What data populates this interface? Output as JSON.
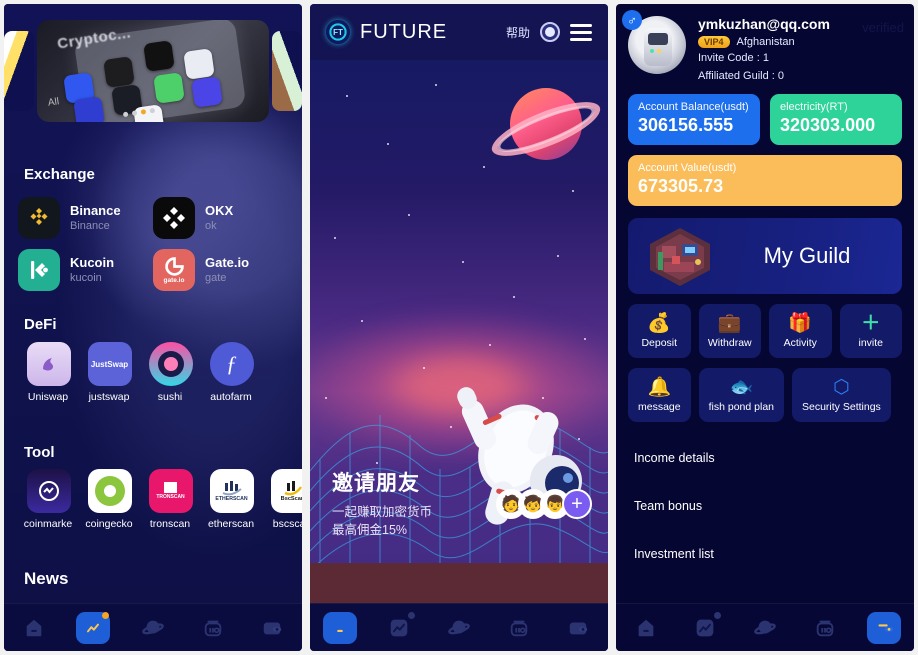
{
  "left_panel": {
    "carousel": {
      "photo_caption": "Cryptoc...",
      "photo_sublabel": "All"
    },
    "sections": [
      {
        "title": "Exchange",
        "type": "exchange",
        "items": [
          {
            "name": "Binance",
            "sub": "Binance",
            "icon": "binance-icon"
          },
          {
            "name": "OKX",
            "sub": "ok",
            "icon": "okx-icon"
          },
          {
            "name": "Kucoin",
            "sub": "kucoin",
            "icon": "kucoin-icon"
          },
          {
            "name": "Gate.io",
            "sub": "gate",
            "icon": "gateio-icon"
          }
        ]
      },
      {
        "title": "DeFi",
        "type": "apps",
        "items": [
          {
            "name": "Uniswap",
            "icon": "uniswap-icon"
          },
          {
            "name": "justswap",
            "icon": "justswap-icon"
          },
          {
            "name": "sushi",
            "icon": "sushi-icon"
          },
          {
            "name": "autofarm",
            "icon": "autofarm-icon"
          }
        ]
      },
      {
        "title": "Tool",
        "type": "apps",
        "items": [
          {
            "name": "coinmarke",
            "icon": "coinmarketcap-icon"
          },
          {
            "name": "coingecko",
            "icon": "coingecko-icon"
          },
          {
            "name": "tronscan",
            "icon": "tronscan-icon"
          },
          {
            "name": "etherscan",
            "icon": "etherscan-icon"
          },
          {
            "name": "bscscan",
            "icon": "bscscan-icon"
          }
        ]
      },
      {
        "title": "News",
        "type": "heading"
      }
    ],
    "nav_active_index": 1
  },
  "middle_panel": {
    "header": {
      "brand": "FUTURE",
      "logo_text": "FT",
      "help": "帮助",
      "sound_icon": "sound-circle-icon",
      "menu_icon": "hamburger-menu-icon"
    },
    "banner": {
      "title": "邀请朋友",
      "subtitle_1": "一起赚取加密货币",
      "subtitle_2": "最高佣金15%",
      "avatars": [
        "🧑",
        "🧒",
        "👦"
      ],
      "add_label": "+"
    },
    "nav_active_index": 0
  },
  "right_panel": {
    "profile": {
      "email": "ymkuzhan@qq.com",
      "vip": "VIP4",
      "country": "Afghanistan",
      "invite_code": "Invite Code : 1",
      "affiliated_guild": "Affiliated Guild : 0",
      "verified": "verified",
      "gender_icon": "male-icon"
    },
    "balance_cards": [
      {
        "label": "Account Balance(usdt)",
        "value": "306156.555",
        "color": "#1e6fee"
      },
      {
        "label": "electricity(RT)",
        "value": "320303.000",
        "color": "#2ed39a"
      }
    ],
    "value_card": {
      "label": "Account Value(usdt)",
      "value": "673305.73",
      "color": "#fbbd5a"
    },
    "guild": {
      "label": "My Guild",
      "icon": "guild-room-icon"
    },
    "actions_row1": [
      {
        "label": "Deposit",
        "icon": "money-bag-icon",
        "glyph": "💰"
      },
      {
        "label": "Withdraw",
        "icon": "briefcase-icon",
        "glyph": "💼"
      },
      {
        "label": "Activity",
        "icon": "gift-icon",
        "glyph": "🎁"
      },
      {
        "label": "invite",
        "icon": "plus-icon",
        "glyph": "＋"
      }
    ],
    "actions_row2": [
      {
        "label": "message",
        "icon": "bell-icon",
        "glyph": "🔔"
      },
      {
        "label": "fish pond plan",
        "icon": "fish-icon",
        "glyph": "🐟"
      },
      {
        "label": "Security Settings",
        "icon": "shield-hex-icon",
        "glyph": "⬡"
      }
    ],
    "menu_items": [
      {
        "label": "Income details"
      },
      {
        "label": "Team bonus"
      },
      {
        "label": "Investment list"
      }
    ],
    "nav_active_index": 4
  },
  "bottom_nav": {
    "items": [
      {
        "icon": "home-icon",
        "name": "nav-home"
      },
      {
        "icon": "trend-chart-icon",
        "name": "nav-market"
      },
      {
        "icon": "planet-icon",
        "name": "nav-planet"
      },
      {
        "icon": "token-icon",
        "name": "nav-token"
      },
      {
        "icon": "wallet-icon",
        "name": "nav-wallet"
      }
    ]
  },
  "colors": {
    "bg_navy": "#0a0b3e",
    "panel_left": "#0e1050",
    "accent_blue": "#1e6fee",
    "accent_green": "#2ed39a",
    "accent_amber": "#fbbd5a",
    "card_navy": "#131a68"
  }
}
